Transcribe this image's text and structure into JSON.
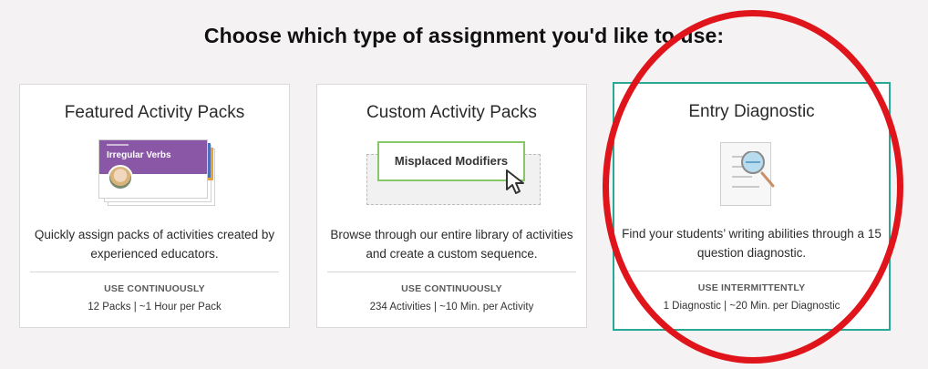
{
  "page": {
    "title": "Choose which type of assignment you'd like to use:"
  },
  "cards": [
    {
      "title": "Featured Activity Packs",
      "illustration_label": "Irregular Verbs",
      "description": "Quickly assign packs of activities created by experienced educators.",
      "frequency": "USE CONTINUOUSLY",
      "stats": "12 Packs | ~1 Hour per Pack",
      "icon": "activity-pack-stack-icon"
    },
    {
      "title": "Custom Activity Packs",
      "illustration_label": "Misplaced Modifiers",
      "description": "Browse through our entire library of activities and create a custom sequence.",
      "frequency": "USE CONTINUOUSLY",
      "stats": "234 Activities | ~10 Min. per Activity",
      "icon": "custom-sequence-icon"
    },
    {
      "title": "Entry Diagnostic",
      "description": "Find your students’ writing abilities through a 15 question diagnostic.",
      "frequency": "USE INTERMITTENTLY",
      "stats": "1 Diagnostic | ~20 Min. per Diagnostic",
      "icon": "diagnostic-magnifier-icon",
      "selected": true
    }
  ],
  "colors": {
    "selected_border": "#28a895",
    "annotation_ring": "#e0141b",
    "pack_purple": "#8a57a6",
    "modifier_green": "#86c76a"
  }
}
